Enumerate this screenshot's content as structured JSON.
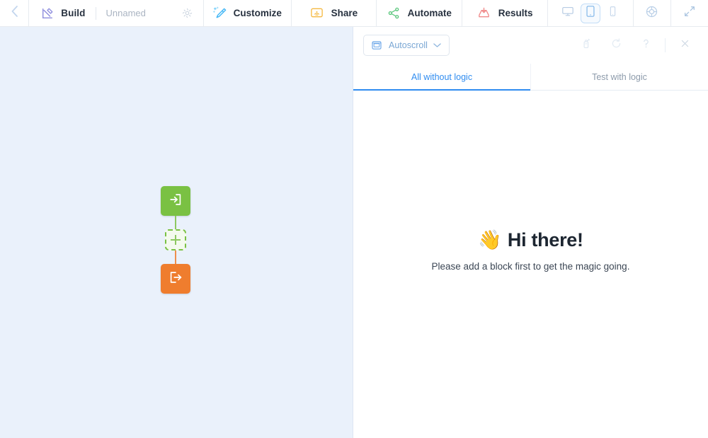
{
  "toolbar": {
    "back_icon": "chevron-left-icon",
    "build": {
      "icon": "build-pen-icon",
      "label": "Build",
      "project_name": "Unnamed",
      "settings_icon": "gear-icon"
    },
    "items": [
      {
        "icon": "magic-wand-icon",
        "label": "Customize"
      },
      {
        "icon": "share-screen-icon",
        "label": "Share"
      },
      {
        "icon": "automate-nodes-icon",
        "label": "Automate"
      },
      {
        "icon": "results-tray-icon",
        "label": "Results"
      }
    ],
    "devices": [
      {
        "icon": "desktop-icon",
        "name": "desktop",
        "active": false
      },
      {
        "icon": "tablet-icon",
        "name": "tablet",
        "active": true
      },
      {
        "icon": "mobile-icon",
        "name": "mobile",
        "active": false
      }
    ],
    "theme_icon": "color-wheel-icon",
    "expand_icon": "expand-arrows-icon"
  },
  "canvas": {
    "start_block": {
      "icon": "sign-in-arrow-icon",
      "color": "#7ac143"
    },
    "add_block": {
      "icon": "plus-icon",
      "color": "#7ac143"
    },
    "end_block": {
      "icon": "sign-out-arrow-icon",
      "color": "#ef7d2e"
    },
    "background_color": "#eaf1fb"
  },
  "preview": {
    "autoscroll": {
      "icon": "autoscroll-icon",
      "label": "Autoscroll",
      "chevron": "chevron-down-icon"
    },
    "actions": [
      {
        "icon": "cleaner-spray-icon",
        "name": "clear-answers"
      },
      {
        "icon": "refresh-icon",
        "name": "restart-preview"
      },
      {
        "icon": "question-mark-icon",
        "name": "help"
      }
    ],
    "close_icon": "close-icon",
    "tabs": [
      {
        "label": "All without logic",
        "active": true
      },
      {
        "label": "Test with logic",
        "active": false
      }
    ],
    "empty_state": {
      "emoji": "👋",
      "title": "Hi there!",
      "subtitle": "Please add a block first to get the magic going."
    }
  },
  "colors": {
    "accent_blue": "#2f8cf0",
    "start_green": "#7ac143",
    "end_orange": "#ef7d2e",
    "canvas_blue": "#eaf1fb"
  }
}
